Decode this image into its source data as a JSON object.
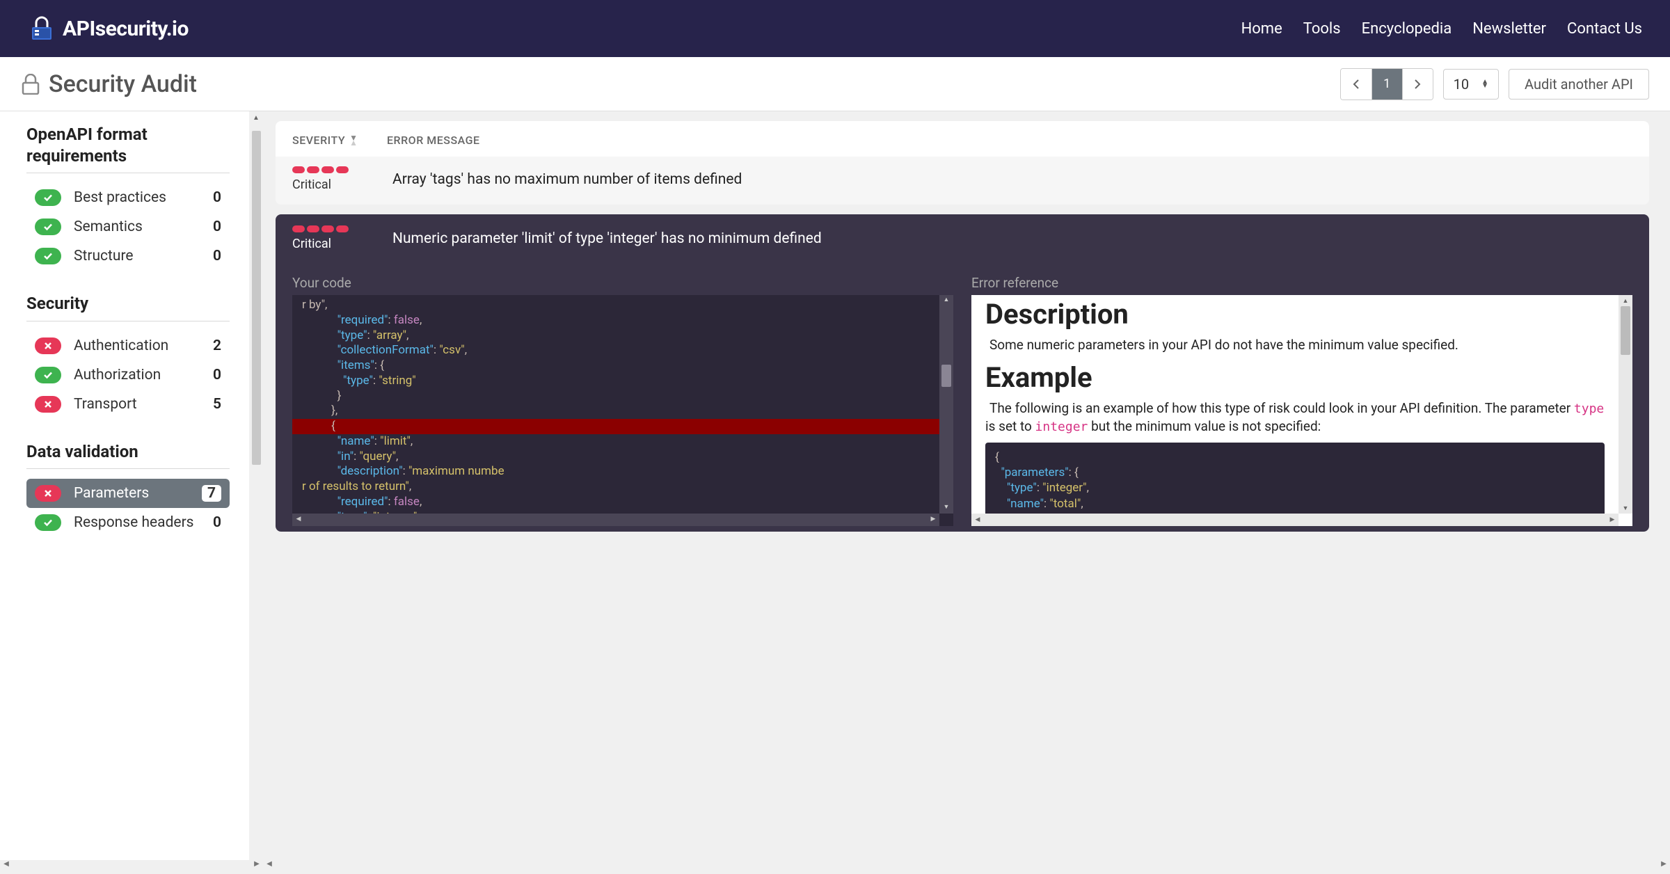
{
  "nav": {
    "logo_text": "APIsecurity.io",
    "items": [
      "Home",
      "Tools",
      "Encyclopedia",
      "Newsletter",
      "Contact Us"
    ]
  },
  "subheader": {
    "title": "Security Audit",
    "page": "1",
    "per_page": "10",
    "audit_btn": "Audit another API"
  },
  "sidebar": {
    "sections": [
      {
        "title": "OpenAPI format requirements",
        "items": [
          {
            "label": "Best practices",
            "count": "0",
            "status": "ok"
          },
          {
            "label": "Semantics",
            "count": "0",
            "status": "ok"
          },
          {
            "label": "Structure",
            "count": "0",
            "status": "ok"
          }
        ]
      },
      {
        "title": "Security",
        "items": [
          {
            "label": "Authentication",
            "count": "2",
            "status": "err"
          },
          {
            "label": "Authorization",
            "count": "0",
            "status": "ok"
          },
          {
            "label": "Transport",
            "count": "5",
            "status": "err"
          }
        ]
      },
      {
        "title": "Data validation",
        "items": [
          {
            "label": "Parameters",
            "count": "7",
            "status": "err",
            "active": true
          },
          {
            "label": "Response headers",
            "count": "0",
            "status": "ok"
          }
        ]
      }
    ]
  },
  "table": {
    "headers": {
      "severity": "SEVERITY",
      "message": "ERROR MESSAGE"
    },
    "rows": [
      {
        "severity": "Critical",
        "pills": 4,
        "message": "Array 'tags' has no maximum number of items defined"
      },
      {
        "severity": "Critical",
        "pills": 4,
        "message": "Numeric parameter 'limit' of type 'integer' has no minimum defined"
      }
    ]
  },
  "detail": {
    "your_code_label": "Your code",
    "error_ref_label": "Error reference",
    "code_lines": [
      {
        "text": "r by\",",
        "frag": true
      },
      {
        "indent": 12,
        "key": "\"required\"",
        "sep": ": ",
        "val_bool": "false",
        "tail": ","
      },
      {
        "indent": 12,
        "key": "\"type\"",
        "sep": ": ",
        "val_str": "\"array\"",
        "tail": ","
      },
      {
        "indent": 12,
        "key": "\"collectionFormat\"",
        "sep": ": ",
        "val_str": "\"csv\"",
        "tail": ","
      },
      {
        "indent": 12,
        "key": "\"items\"",
        "sep": ": ",
        "punc": "{"
      },
      {
        "indent": 14,
        "key": "\"type\"",
        "sep": ": ",
        "val_str": "\"string\""
      },
      {
        "indent": 12,
        "punc": "}"
      },
      {
        "indent": 10,
        "punc": "},"
      },
      {
        "indent": 10,
        "punc": "{",
        "highlight": true
      },
      {
        "indent": 12,
        "key": "\"name\"",
        "sep": ": ",
        "val_str": "\"limit\"",
        "tail": ","
      },
      {
        "indent": 12,
        "key": "\"in\"",
        "sep": ": ",
        "val_str": "\"query\"",
        "tail": ","
      },
      {
        "indent": 12,
        "key": "\"description\"",
        "sep": ": ",
        "val_str": "\"maximum numbe",
        "wrap_next": "r of results to return\"",
        "tail": ","
      },
      {
        "indent": 12,
        "key": "\"required\"",
        "sep": ": ",
        "val_bool": "false",
        "tail": ","
      },
      {
        "indent": 12,
        "key": "\"type\"",
        "sep": ": ",
        "val_str": "\"integer\"",
        "tail": ","
      }
    ],
    "ref": {
      "h1": "Description",
      "p1": "Some numeric parameters in your API do not have the minimum value specified.",
      "h2": "Example",
      "p2_a": "The following is an example of how this type of risk could look in your API definition. The parameter ",
      "p2_code1": "type",
      "p2_b": " is set to ",
      "p2_code2": "integer",
      "p2_c": " but the minimum value is not specified:",
      "code_lines": [
        {
          "punc": "{"
        },
        {
          "indent": 2,
          "key": "\"parameters\"",
          "sep": ": ",
          "punc": "{"
        },
        {
          "indent": 4,
          "key": "\"type\"",
          "sep": ": ",
          "val_str": "\"integer\"",
          "tail": ","
        },
        {
          "indent": 4,
          "key": "\"name\"",
          "sep": ": ",
          "val_str": "\"total\"",
          "tail": ","
        }
      ]
    }
  }
}
